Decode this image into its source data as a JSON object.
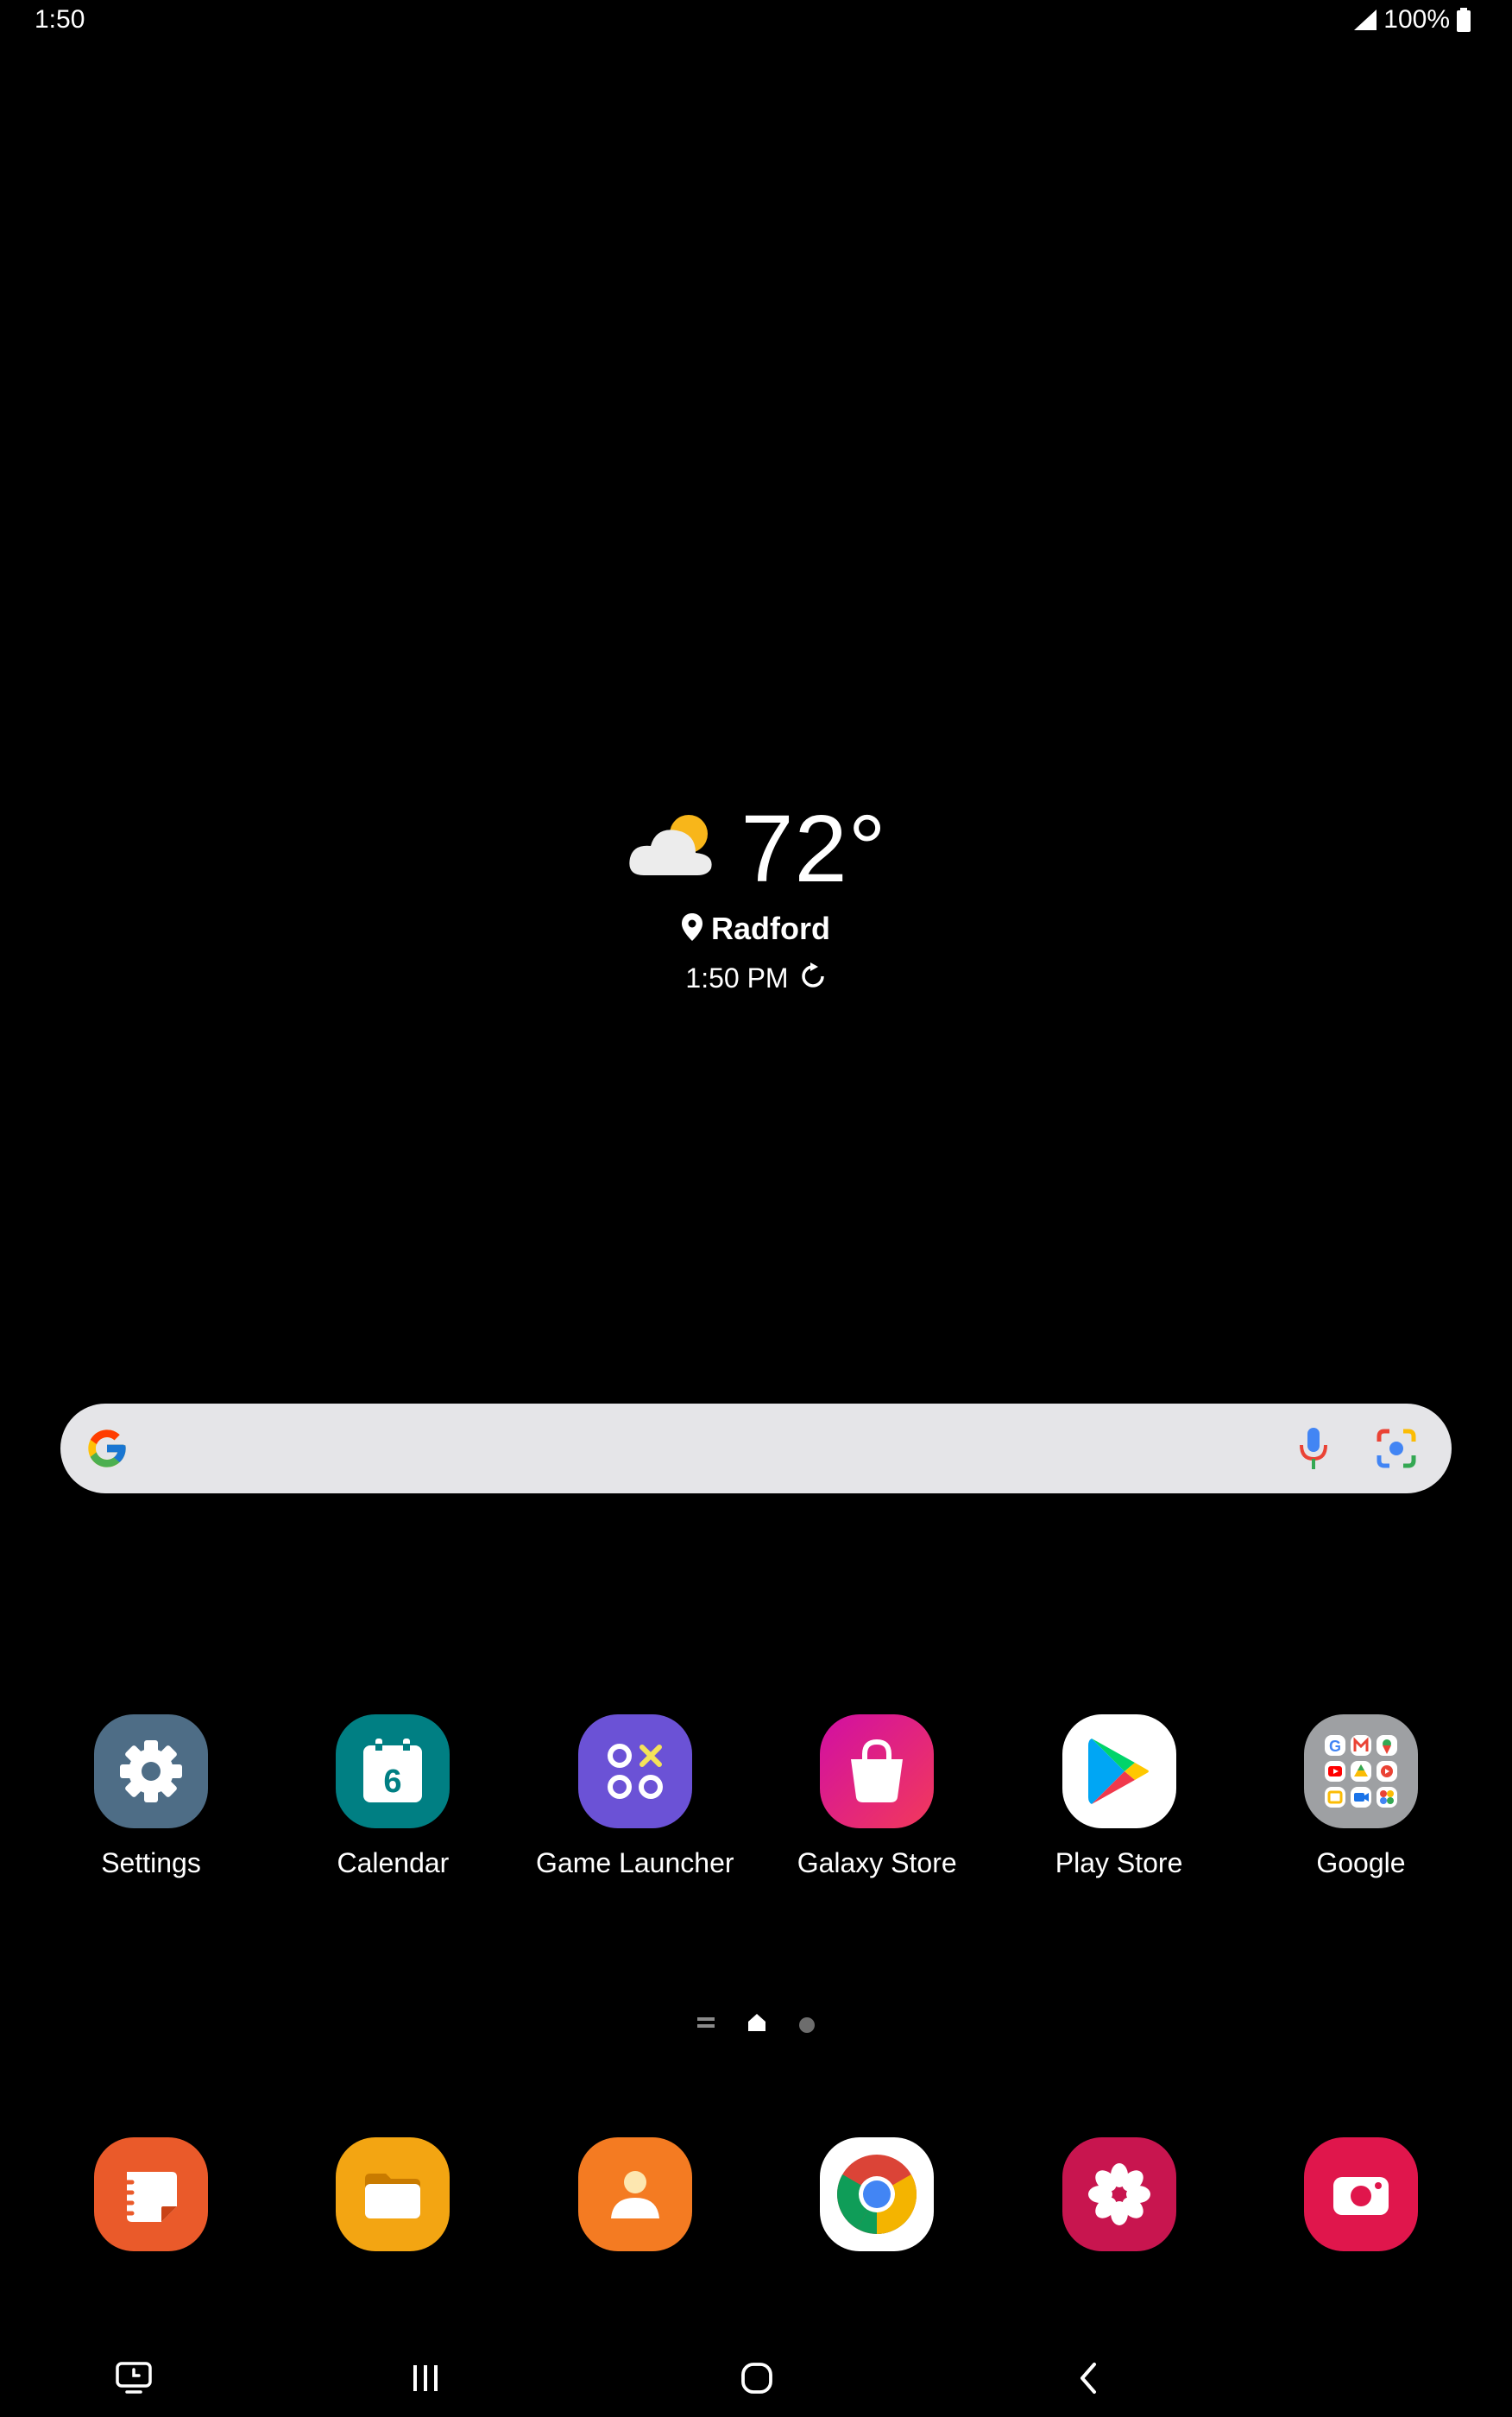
{
  "status_bar": {
    "time": "1:50",
    "battery_percent": "100%",
    "signal_icon": "cell-signal-icon",
    "battery_icon": "battery-full-icon"
  },
  "weather": {
    "temperature": "72°",
    "location": "Radford",
    "updated_time": "1:50 PM",
    "condition_icon": "partly-cloudy-icon"
  },
  "search": {
    "logo": "google-g-icon",
    "mic_icon": "microphone-icon",
    "lens_icon": "google-lens-icon"
  },
  "apps": [
    {
      "label": "Settings",
      "icon": "gear-icon",
      "color": "#4e6d86"
    },
    {
      "label": "Calendar",
      "icon": "calendar-icon",
      "color": "#007f83",
      "day": "6"
    },
    {
      "label": "Game Launcher",
      "icon": "game-launcher-icon",
      "color": "#6b52d6"
    },
    {
      "label": "Galaxy Store",
      "icon": "shopping-bag-icon",
      "color": "#e3148e"
    },
    {
      "label": "Play Store",
      "icon": "play-store-icon",
      "color": "#ffffff"
    },
    {
      "label": "Google",
      "icon": "google-folder-icon",
      "color": "#9ea0a3"
    }
  ],
  "page_indicator": {
    "pages": 3,
    "current": 1
  },
  "dock": [
    {
      "name": "samsung-notes",
      "icon": "notes-icon",
      "color": "#ea5a2a"
    },
    {
      "name": "my-files",
      "icon": "folder-icon",
      "color": "#f3a512"
    },
    {
      "name": "contacts",
      "icon": "person-icon",
      "color": "#f47b22"
    },
    {
      "name": "chrome",
      "icon": "chrome-icon",
      "color": "#ffffff"
    },
    {
      "name": "gallery",
      "icon": "flower-icon",
      "color": "#c8154f"
    },
    {
      "name": "camera",
      "icon": "camera-icon",
      "color": "#e0164c"
    }
  ],
  "nav_bar": {
    "recent_apps_tool": "screen-timer-icon",
    "recents": "recents-icon",
    "home": "home-icon",
    "back": "back-icon"
  }
}
